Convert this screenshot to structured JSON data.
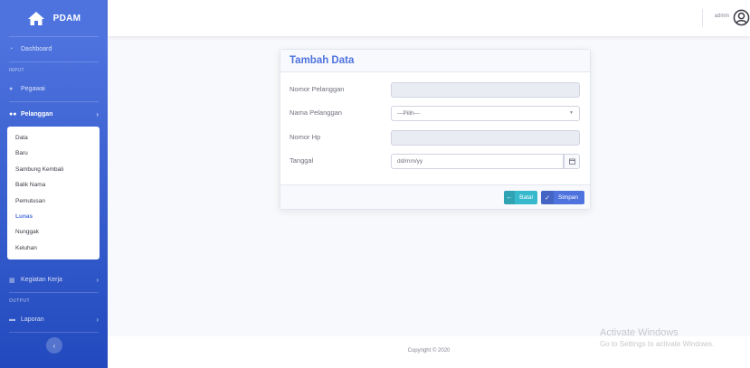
{
  "sidebar": {
    "brand": "PDAM",
    "dashboard": "Dashboard",
    "heading_input": "INPUT",
    "pegawai": "Pegawai",
    "pelanggan": "Pelanggan",
    "submenu": [
      "Data",
      "Baru",
      "Sambung Kembali",
      "Balik Nama",
      "Pemutusan",
      "Lunas",
      "Nunggak",
      "Keluhan"
    ],
    "active_sub": "Lunas",
    "kegiatan": "Kegiatan Kerja",
    "heading_output": "OUTPUT",
    "laporan": "Laporan"
  },
  "topbar": {
    "username": "admin"
  },
  "card": {
    "title": "Tambah Data",
    "fields": {
      "nomor_pelanggan": {
        "label": "Nomor Pelanggan",
        "value": ""
      },
      "nama_pelanggan": {
        "label": "Nama Pelanggan",
        "value": "---Pilih---"
      },
      "nomor_hp": {
        "label": "Nomor Hp",
        "value": ""
      },
      "tanggal": {
        "label": "Tanggal",
        "value": "dd/mm/yy"
      }
    },
    "buttons": {
      "batal": "Batal",
      "simpan": "Simpan"
    }
  },
  "footer": {
    "copyright": "Copyright © 2020"
  },
  "watermark": {
    "line1": "Activate Windows",
    "line2": "Go to Settings to activate Windows."
  },
  "colors": {
    "primary": "#4e73df",
    "info": "#36b9cc",
    "sidebar_dark": "#224abe"
  }
}
